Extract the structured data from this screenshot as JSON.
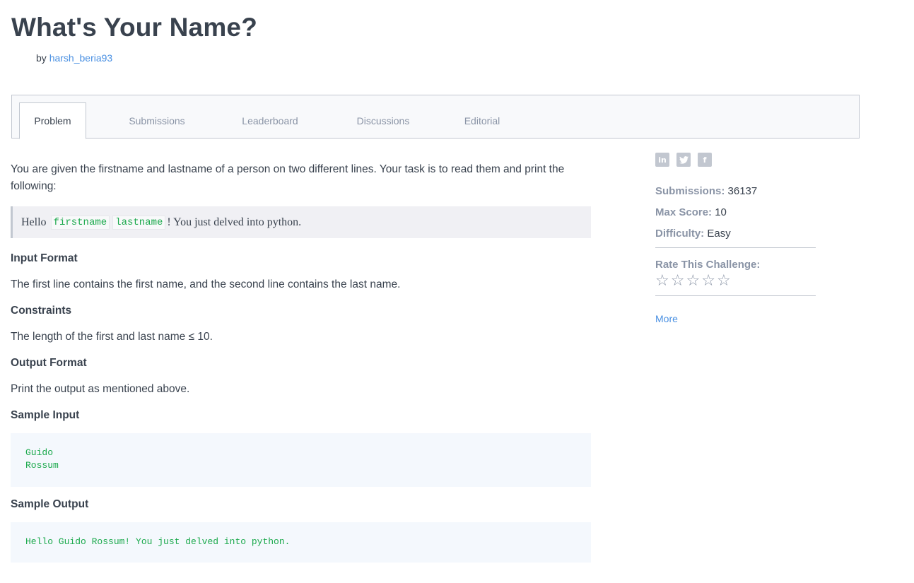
{
  "challenge": {
    "title": "What's Your Name?",
    "by_prefix": "by",
    "author": "harsh_beria93"
  },
  "tabs": [
    {
      "label": "Problem",
      "active": true
    },
    {
      "label": "Submissions",
      "active": false
    },
    {
      "label": "Leaderboard",
      "active": false
    },
    {
      "label": "Discussions",
      "active": false
    },
    {
      "label": "Editorial",
      "active": false
    }
  ],
  "problem": {
    "intro": "You are given the firstname and lastname of a person on two different lines. Your task is to read them and print the following:",
    "quote": {
      "hello": "Hello",
      "firstname": "firstname",
      "lastname": "lastname",
      "rest": "! You just delved into python."
    },
    "input_format_heading": "Input Format",
    "input_format_text": "The first line contains the first name, and the second line contains the last name.",
    "constraints_heading": "Constraints",
    "constraints_text": "The length of the first and last name ≤ 10.",
    "output_format_heading": "Output Format",
    "output_format_text": "Print the output as mentioned above.",
    "sample_input_heading": "Sample Input",
    "sample_input_lines": [
      "Guido",
      "Rossum"
    ],
    "sample_output_heading": "Sample Output",
    "sample_output_text": "Hello Guido Rossum! You just delved into python."
  },
  "sidebar": {
    "social_icons": [
      "linkedin-icon",
      "twitter-icon",
      "facebook-icon"
    ],
    "submissions_label": "Submissions:",
    "submissions_value": "36137",
    "max_score_label": "Max Score:",
    "max_score_value": "10",
    "difficulty_label": "Difficulty:",
    "difficulty_value": "Easy",
    "rate_label": "Rate This Challenge:",
    "rating": 0,
    "more_label": "More"
  },
  "colors": {
    "text": "#39424e",
    "muted": "#8a94a6",
    "link": "#4a90e2",
    "code_green": "#1ba94c",
    "border": "#c2c7d0"
  }
}
